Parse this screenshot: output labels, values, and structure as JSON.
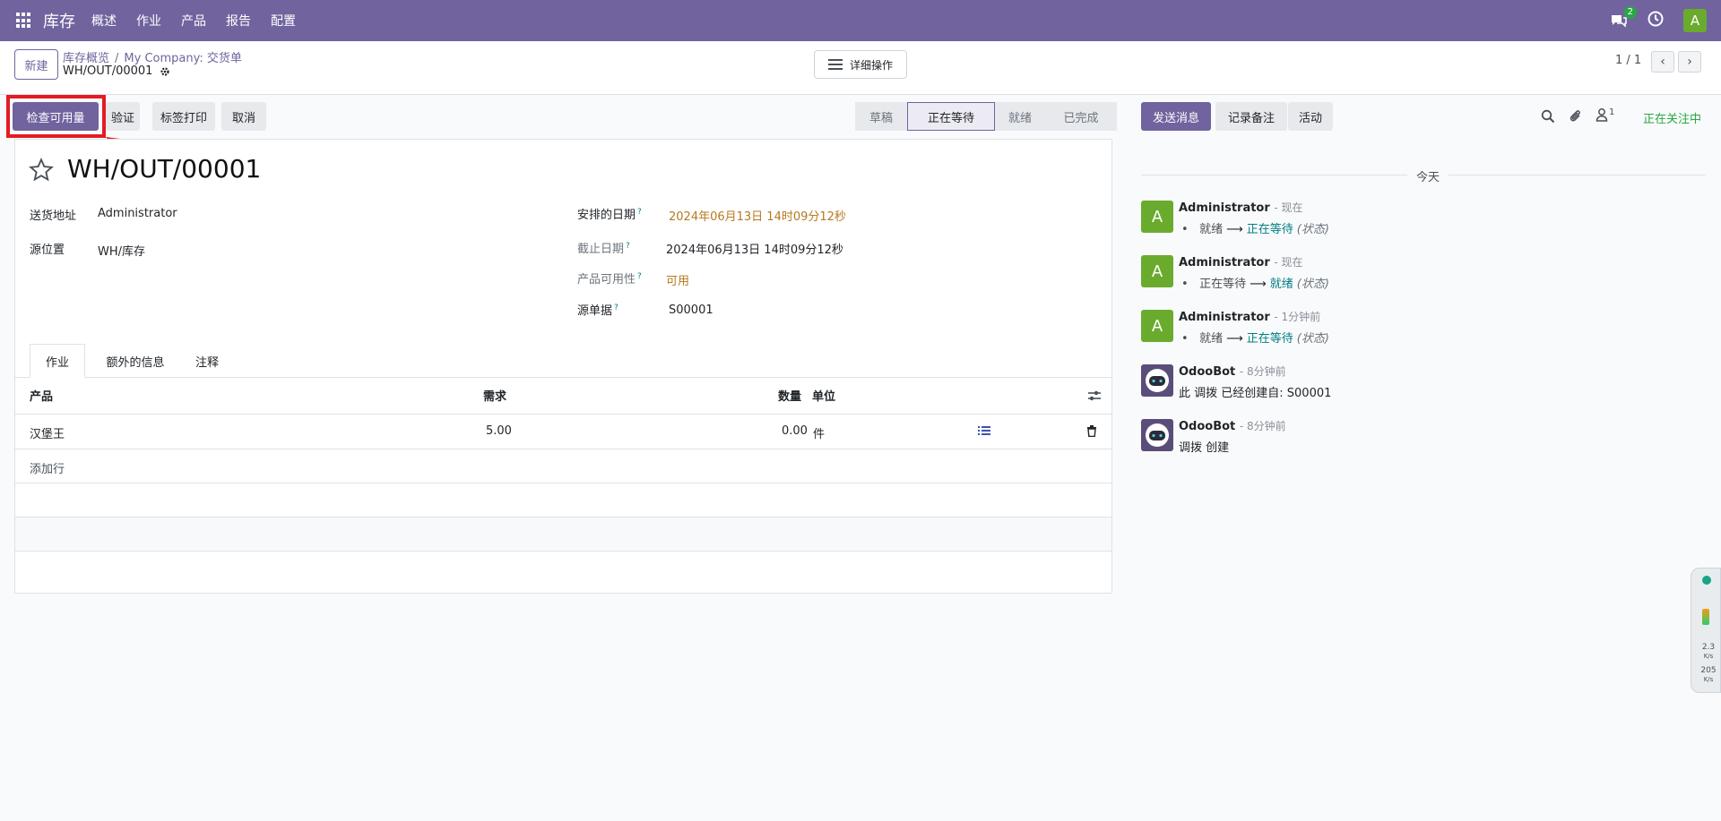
{
  "nav": {
    "app_name": "库存",
    "menu": [
      "概述",
      "作业",
      "产品",
      "报告",
      "配置"
    ],
    "messages_badge": "2",
    "user_initial": "A"
  },
  "control": {
    "new_label": "新建",
    "breadcrumb": [
      "库存概览",
      "My Company: 交货单"
    ],
    "breadcrumb_sep": "/",
    "record_name": "WH/OUT/00001",
    "actions_label": "详细操作",
    "pager": "1 / 1"
  },
  "buttons": {
    "check_availability": "检查可用量",
    "validate": "验证",
    "print_labels": "标签打印",
    "cancel": "取消"
  },
  "status": {
    "stages": [
      "草稿",
      "正在等待",
      "就绪",
      "已完成"
    ],
    "active": "正在等待"
  },
  "form": {
    "title": "WH/OUT/00001",
    "delivery_address_label": "送货地址",
    "delivery_address_value": "Administrator",
    "source_location_label": "源位置",
    "source_location_value": "WH/库存",
    "scheduled_date_label": "安排的日期",
    "scheduled_date_value": "2024年06月13日 14时09分12秒",
    "deadline_label": "截止日期",
    "deadline_value": "2024年06月13日 14时09分12秒",
    "availability_label": "产品可用性",
    "availability_value": "可用",
    "source_doc_label": "源单据",
    "source_doc_value": "S00001",
    "help_mark": "?"
  },
  "tabs": [
    "作业",
    "额外的信息",
    "注释"
  ],
  "table": {
    "headers": [
      "产品",
      "需求",
      "数量",
      "单位"
    ],
    "rows": [
      {
        "product": "汉堡王",
        "demand": "5.00",
        "quantity": "0.00",
        "uom": "件"
      }
    ],
    "add_line": "添加行"
  },
  "chatter": {
    "send_message": "发送消息",
    "log_note": "记录备注",
    "activity": "活动",
    "followers_count": "1",
    "following": "正在关注中",
    "today": "今天",
    "messages": [
      {
        "author": "Administrator",
        "time": "- 现在",
        "from": "就绪",
        "to": "正在等待",
        "field": "(状态)"
      },
      {
        "author": "Administrator",
        "time": "- 现在",
        "from": "正在等待",
        "to": "就绪",
        "field": "(状态)"
      },
      {
        "author": "Administrator",
        "time": "- 1分钟前",
        "from": "就绪",
        "to": "正在等待",
        "field": "(状态)"
      },
      {
        "author": "OdooBot",
        "time": "- 8分钟前",
        "text": "此 调拨 已经创建自: S00001"
      },
      {
        "author": "OdooBot",
        "time": "- 8分钟前",
        "text": "调拨 创建"
      }
    ]
  },
  "widget": {
    "up": "2.3",
    "up_unit": "K/s",
    "down": "205",
    "down_unit": "K/s"
  },
  "colors": {
    "brand": "#71639e",
    "highlight": "#e31b23",
    "avatar": "#6aab2e",
    "following": "#28a745"
  }
}
